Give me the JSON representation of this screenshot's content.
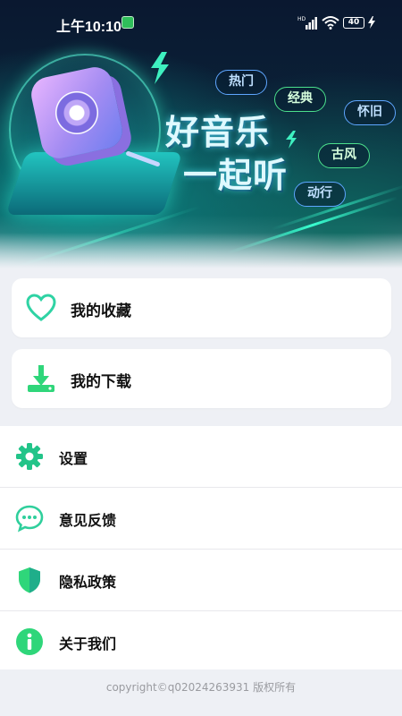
{
  "status_bar": {
    "time": "上午10:10",
    "battery": "40",
    "network_label": "HD"
  },
  "banner": {
    "slogan_line1": "好音乐",
    "slogan_line2": "一起听",
    "tags": [
      "热门",
      "经典",
      "怀旧",
      "古风",
      "动行"
    ]
  },
  "cards": [
    {
      "label": "我的收藏",
      "icon": "heart-icon"
    },
    {
      "label": "我的下载",
      "icon": "download-icon"
    }
  ],
  "menu": [
    {
      "label": "设置",
      "icon": "gear-icon"
    },
    {
      "label": "意见反馈",
      "icon": "chat-bubble-icon"
    },
    {
      "label": "隐私政策",
      "icon": "shield-icon"
    },
    {
      "label": "关于我们",
      "icon": "info-icon"
    }
  ],
  "footer": {
    "copyright": "copyright©q02024263931 版权所有"
  },
  "colors": {
    "accent_green": "#2fd67a",
    "accent_teal": "#20c9a6",
    "background": "#eef0f5"
  }
}
